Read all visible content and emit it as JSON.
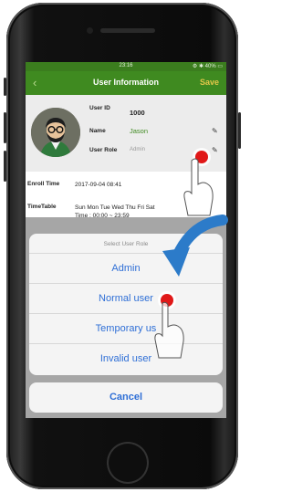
{
  "status_bar": {
    "time": "23:16",
    "right": "⚙ ✱ 40% ▭"
  },
  "header": {
    "back_icon": "chevron-left-icon",
    "title": "User Information",
    "save_label": "Save"
  },
  "profile": {
    "user_id_label": "User ID",
    "user_id_value": "1000",
    "name_label": "Name",
    "name_value": "Jason",
    "role_label": "User Role",
    "role_value": "Admin"
  },
  "enroll": {
    "label": "Enroll Time",
    "value": "2017-09-04 08:41"
  },
  "timetable": {
    "label": "TimeTable",
    "days": "Sun Mon Tue Wed Thu Fri Sat",
    "time": "Time : 00:00 ~ 23:59"
  },
  "sheet": {
    "title": "Select User Role",
    "options": [
      "Admin",
      "Normal user",
      "Temporary us",
      "Invalid user"
    ],
    "cancel_label": "Cancel"
  },
  "colors": {
    "header_green": "#3f8a20",
    "action_blue": "#2f6fd6",
    "touch_red": "#e01818",
    "arrow_blue": "#2c7bc9"
  }
}
